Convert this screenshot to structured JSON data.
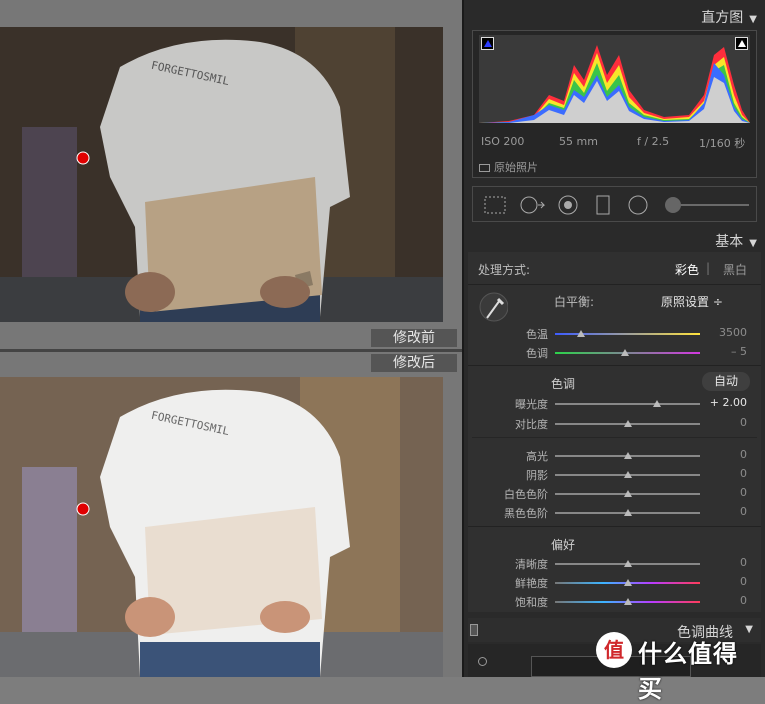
{
  "compare": {
    "before_label": "修改前",
    "after_label": "修改后"
  },
  "panel": {
    "histogram": {
      "title": "直方图",
      "iso": "ISO 200",
      "focal": "55 mm",
      "aperture": "f / 2.5",
      "shutter": "1/160 秒",
      "original_photo": "原始照片"
    },
    "basic": {
      "title": "基本",
      "treatment_label": "处理方式:",
      "color_option": "彩色",
      "separator": "|",
      "bw_option": "黑白",
      "wb_label": "白平衡:",
      "wb_value": "原照设置 ÷",
      "tone_title": "色调",
      "auto_button": "自动",
      "presence_title": "偏好",
      "sliders": {
        "temp": {
          "label": "色温",
          "value": "3500",
          "level": 0.18
        },
        "tint": {
          "label": "色调",
          "value": "– 5",
          "level": 0.48
        },
        "exposure": {
          "label": "曝光度",
          "value": "+ 2.00",
          "level": 0.7
        },
        "contrast": {
          "label": "对比度",
          "value": "0",
          "level": 0.5
        },
        "highlights": {
          "label": "高光",
          "value": "0",
          "level": 0.5
        },
        "shadows": {
          "label": "阴影",
          "value": "0",
          "level": 0.5
        },
        "whites": {
          "label": "白色色阶",
          "value": "0",
          "level": 0.5
        },
        "blacks": {
          "label": "黑色色阶",
          "value": "0",
          "level": 0.5
        },
        "clarity": {
          "label": "清晰度",
          "value": "0",
          "level": 0.5
        },
        "vibrance": {
          "label": "鲜艳度",
          "value": "0",
          "level": 0.5
        },
        "saturation": {
          "label": "饱和度",
          "value": "0",
          "level": 0.5
        }
      }
    },
    "tone_curve": {
      "title": "色调曲线"
    }
  },
  "watermark": {
    "text": "什么值得买",
    "badge": "值"
  },
  "colors": {
    "panel_bg": "#2a2a2a",
    "accent_marker": "#e00000"
  }
}
